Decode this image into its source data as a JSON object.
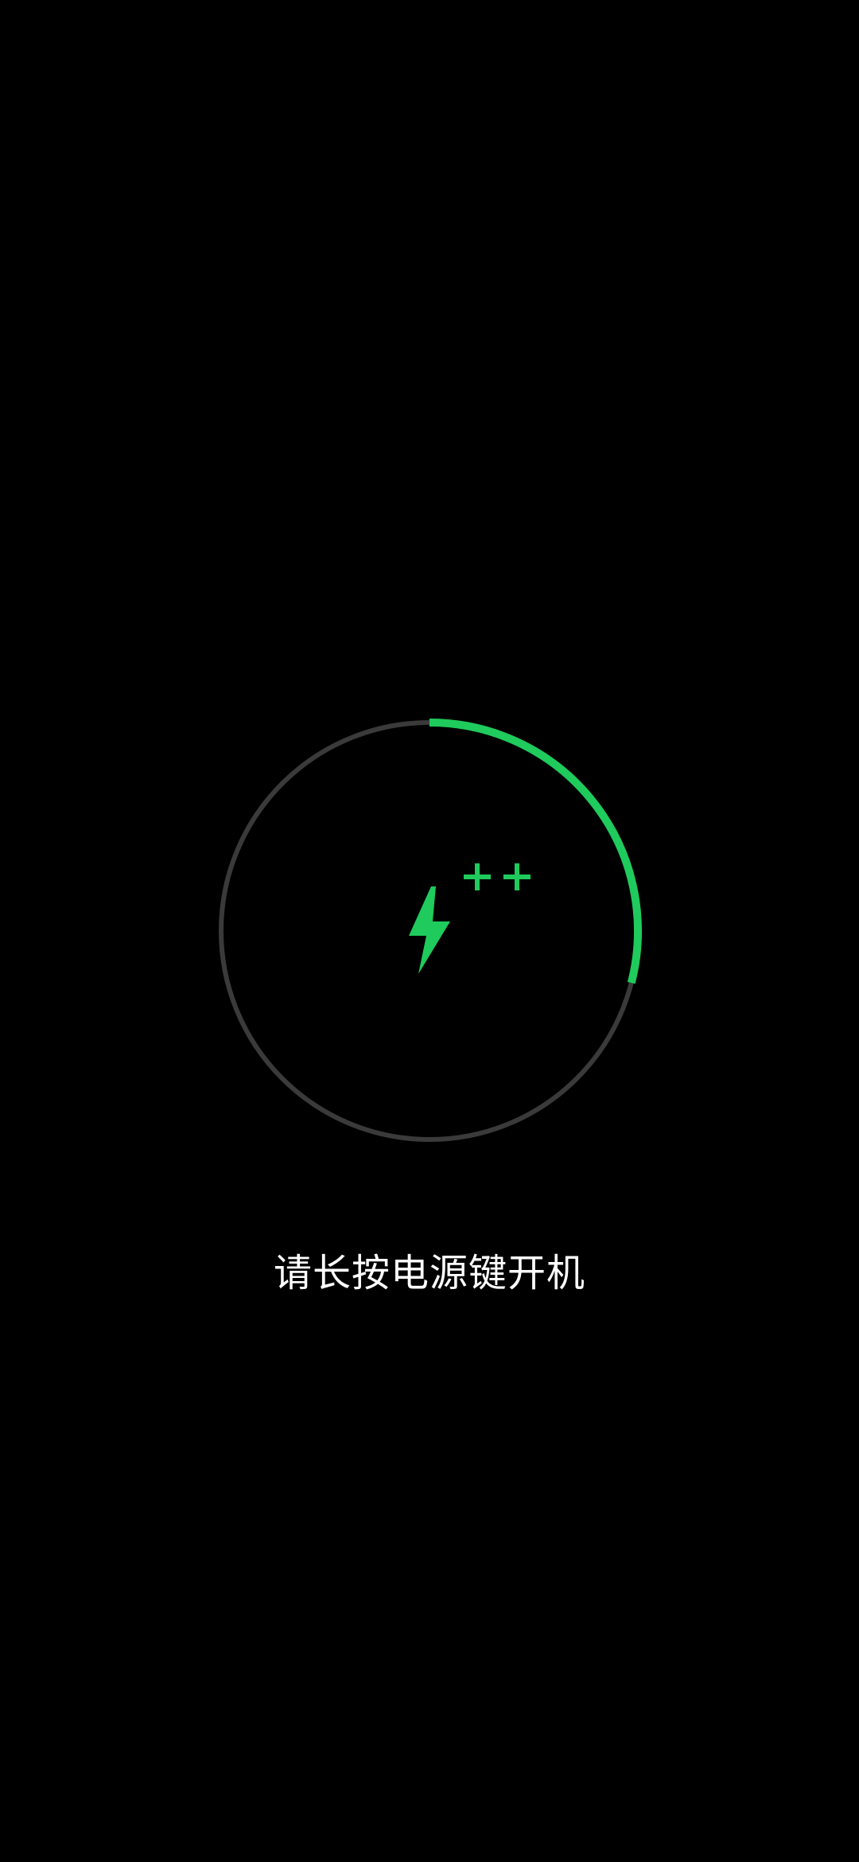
{
  "screen": {
    "message": "请长按电源键开机"
  },
  "battery": {
    "charge_fraction": 0.29,
    "status": "charging",
    "boost_indicator": "++"
  },
  "icons": {
    "bolt": "lightning-bolt-icon",
    "boost": "plus-icon"
  },
  "colors": {
    "background": "#000000",
    "accent": "#1fcb5c",
    "track": "#3a3a3a",
    "text": "#ffffff"
  }
}
